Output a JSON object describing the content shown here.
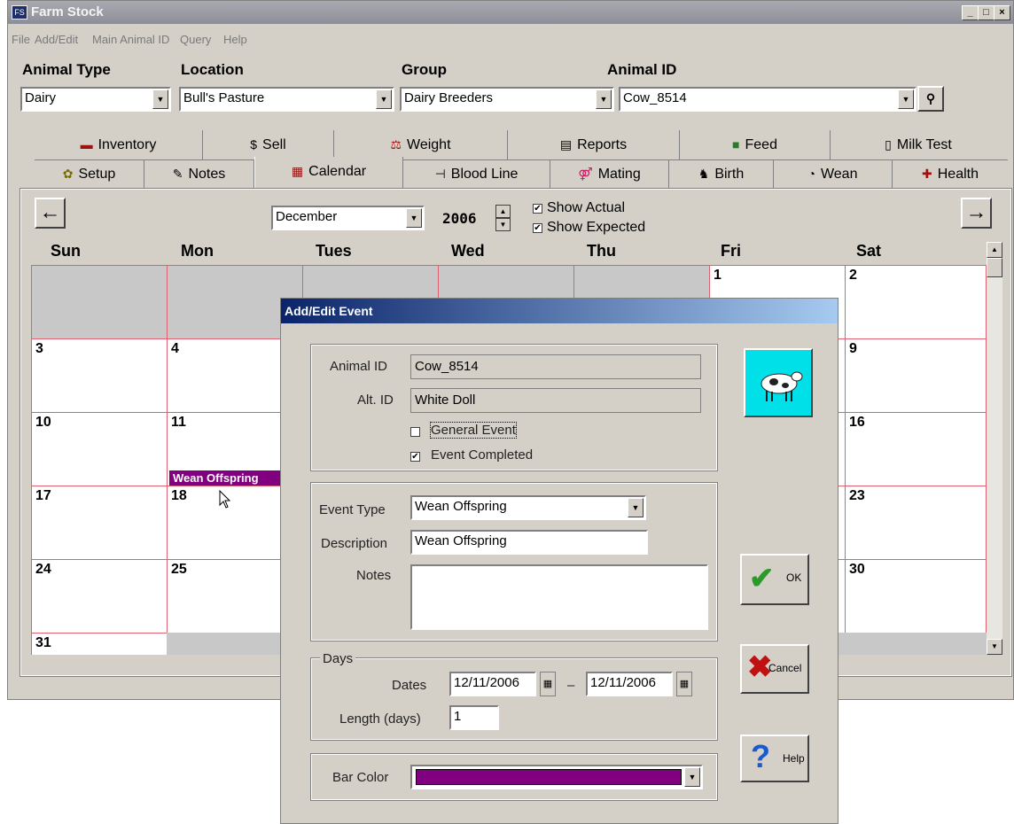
{
  "window": {
    "title": "Farm Stock"
  },
  "menu": [
    "File",
    "Add/Edit",
    "Main Animal ID",
    "Query",
    "Help"
  ],
  "filters": {
    "animal_type": {
      "label": "Animal Type",
      "value": "Dairy"
    },
    "location": {
      "label": "Location",
      "value": "Bull's Pasture"
    },
    "group": {
      "label": "Group",
      "value": "Dairy Breeders"
    },
    "animal_id": {
      "label": "Animal ID",
      "value": "Cow_8514"
    }
  },
  "tabs_row1": [
    "Inventory",
    "Sell",
    "Weight",
    "Reports",
    "Feed",
    "Milk Test"
  ],
  "tabs_row2": [
    "Setup",
    "Notes",
    "Calendar",
    "Blood Line",
    "Mating",
    "Birth",
    "Wean",
    "Health"
  ],
  "calendar": {
    "month": "December",
    "year": "2006",
    "show_actual": "Show Actual",
    "show_expected": "Show Expected",
    "days": [
      "Sun",
      "Mon",
      "Tues",
      "Wed",
      "Thu",
      "Fri",
      "Sat"
    ],
    "event_bar": "Wean Offspring"
  },
  "dialog": {
    "title": "Add/Edit Event",
    "animal_id_label": "Animal ID",
    "animal_id": "Cow_8514",
    "alt_id_label": "Alt. ID",
    "alt_id": "White Doll",
    "general_event": "General Event",
    "event_completed": "Event Completed",
    "event_type_label": "Event Type",
    "event_type": "Wean Offspring",
    "description_label": "Description",
    "description": "Wean Offspring",
    "notes_label": "Notes",
    "days_group": "Days",
    "dates_label": "Dates",
    "date_from": "12/11/2006",
    "date_sep": "–",
    "date_to": "12/11/2006",
    "length_label": "Length (days)",
    "length": "1",
    "bar_color_label": "Bar Color",
    "bar_color": "#800080",
    "ok": "OK",
    "cancel": "Cancel",
    "help": "Help"
  }
}
